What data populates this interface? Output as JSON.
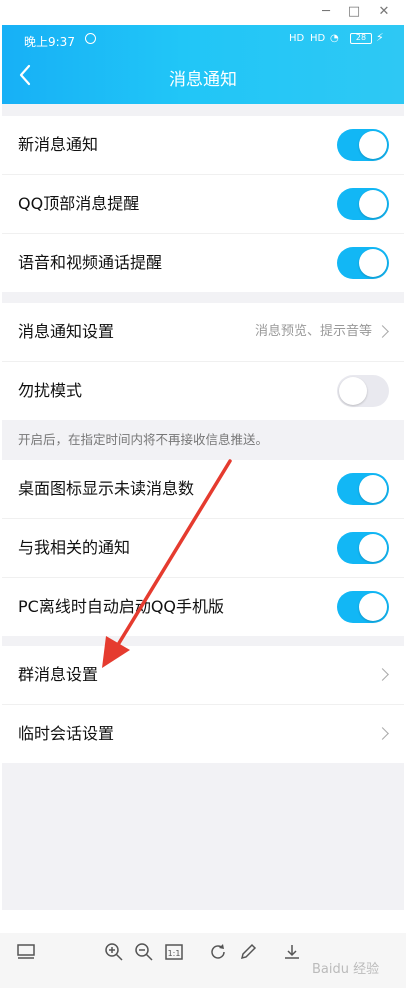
{
  "status_bar": {
    "time": "晚上9:37",
    "signal1": "HD",
    "signal2": "HD",
    "battery": "28"
  },
  "header": {
    "title": "消息通知"
  },
  "group1": [
    {
      "label": "新消息通知",
      "on": true
    },
    {
      "label": "QQ顶部消息提醒",
      "on": true
    },
    {
      "label": "语音和视频通话提醒",
      "on": true
    }
  ],
  "group2": {
    "settings_label": "消息通知设置",
    "settings_value": "消息预览、提示音等",
    "dnd_label": "勿扰模式",
    "dnd_on": false,
    "hint": "开启后，在指定时间内将不再接收信息推送。"
  },
  "group3": [
    {
      "label": "桌面图标显示未读消息数",
      "on": true
    },
    {
      "label": "与我相关的通知",
      "on": true
    },
    {
      "label": "PC离线时自动启动QQ手机版",
      "on": true
    }
  ],
  "group4": [
    {
      "label": "群消息设置"
    },
    {
      "label": "临时会话设置"
    }
  ],
  "colors": {
    "accent": "#12b7f5",
    "arrow": "#e53b2f"
  },
  "watermark": "Baidu 经验"
}
